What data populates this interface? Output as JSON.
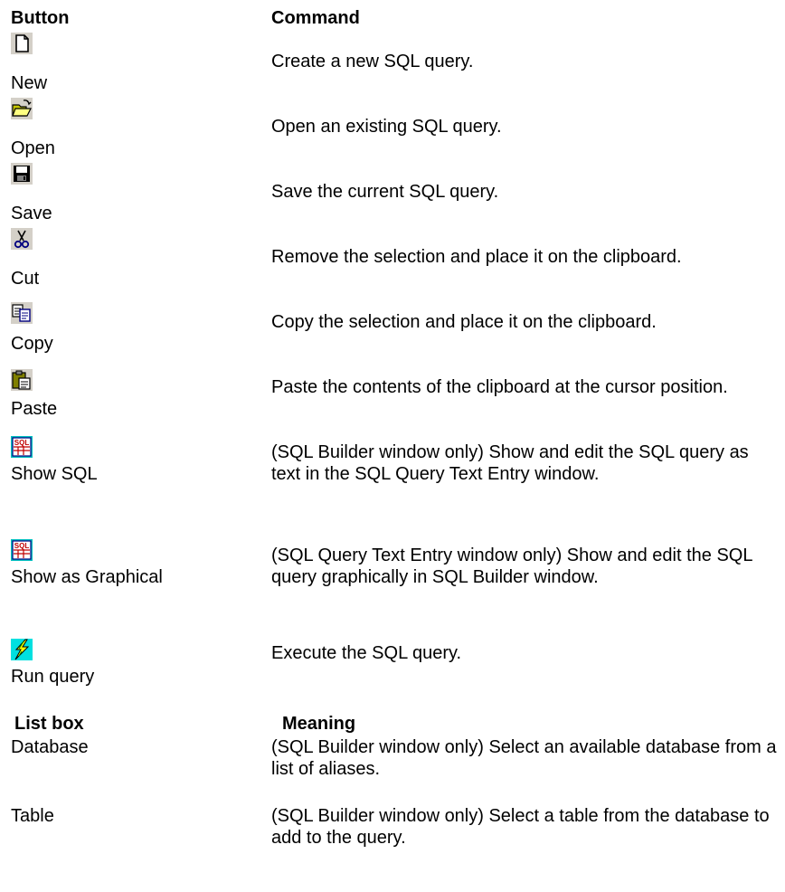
{
  "button_table": {
    "header_button": "Button",
    "header_command": "Command",
    "rows": [
      {
        "icon": "new-document-icon",
        "label": "New",
        "command": "Create a new SQL query."
      },
      {
        "icon": "open-folder-icon",
        "label": "Open",
        "command": "Open an existing SQL query."
      },
      {
        "icon": "save-disk-icon",
        "label": "Save",
        "command": "Save the current SQL query."
      },
      {
        "icon": "scissors-cut-icon",
        "label": "Cut",
        "command": "Remove the selection and place it on the clipboard."
      },
      {
        "icon": "copy-pages-icon",
        "label": "Copy",
        "command": "Copy the selection and place it on the clipboard."
      },
      {
        "icon": "clipboard-paste-icon",
        "label": "Paste",
        "command": "Paste the contents of the clipboard at the cursor position."
      },
      {
        "icon": "sql-grid-icon",
        "label": "Show SQL",
        "command": "(SQL Builder window only) Show and edit the SQL query as text in the SQL Query Text Entry window."
      },
      {
        "icon": "sql-grid-icon",
        "label": "Show as Graphical",
        "command": "(SQL Query Text Entry window only) Show and edit the SQL query graphically in SQL Builder window."
      },
      {
        "icon": "lightning-run-icon",
        "label": "Run query",
        "command": "Execute the SQL query."
      }
    ]
  },
  "listbox_table": {
    "header_listbox": "List box",
    "header_meaning": "Meaning",
    "rows": [
      {
        "name": "Database",
        "meaning": "(SQL Builder window only) Select an available database from a list of aliases."
      },
      {
        "name": "Table",
        "meaning": "(SQL Builder window only) Select a table from the database to add to the query."
      }
    ]
  }
}
